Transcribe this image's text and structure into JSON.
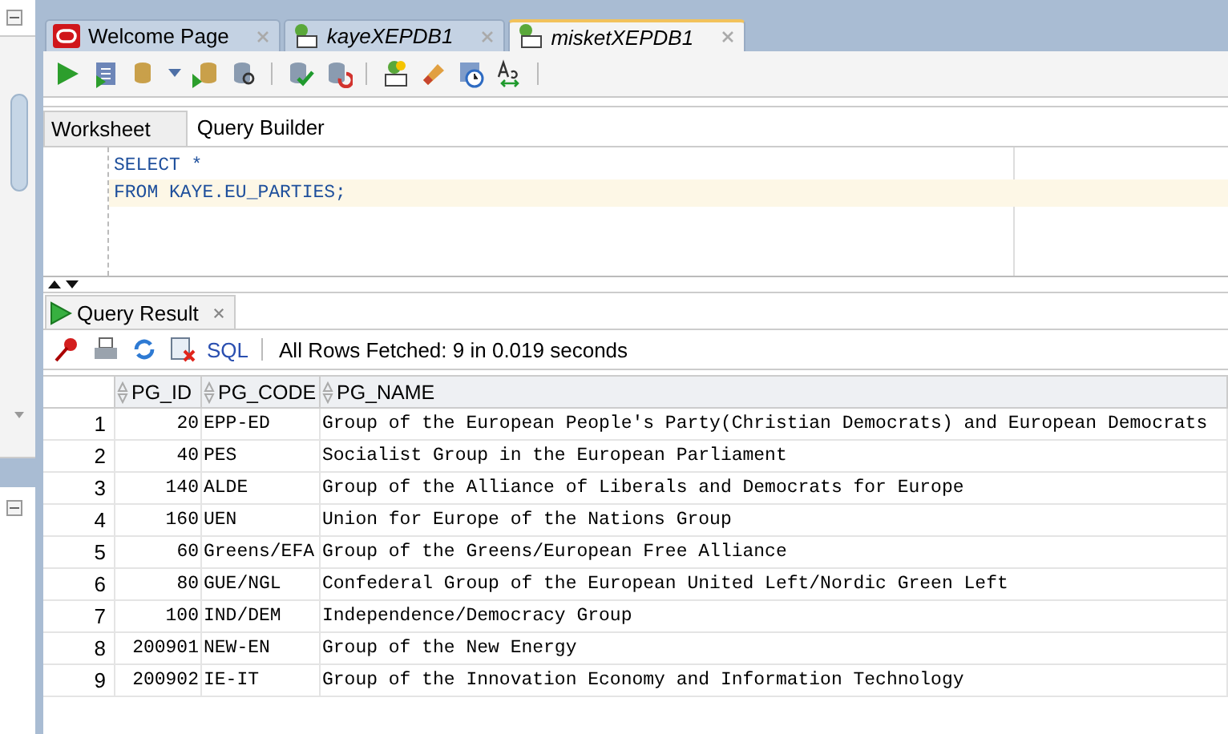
{
  "document_tabs": [
    {
      "label": "Welcome Page",
      "kind": "oracle",
      "selected": false
    },
    {
      "label": "kayeXEPDB1",
      "kind": "sql",
      "selected": false
    },
    {
      "label": "misketXEPDB1",
      "kind": "sql",
      "selected": true
    }
  ],
  "editor_tabs": [
    {
      "label": "Worksheet",
      "selected": true
    },
    {
      "label": "Query Builder",
      "selected": false
    }
  ],
  "editor": {
    "lines": [
      {
        "text": "SELECT *",
        "current": false
      },
      {
        "text": "FROM KAYE.EU_PARTIES;",
        "current": true
      }
    ]
  },
  "result_tab": {
    "label": "Query Result"
  },
  "result_toolbar": {
    "sql_link": "SQL",
    "status": "All Rows Fetched: 9 in 0.019 seconds"
  },
  "table": {
    "columns": [
      "PG_ID",
      "PG_CODE",
      "PG_NAME"
    ],
    "rows": [
      {
        "number": "1",
        "cells": [
          "20",
          "EPP-ED",
          "Group of the European People's Party(Christian Democrats) and European Democrats"
        ]
      },
      {
        "number": "2",
        "cells": [
          "40",
          "PES",
          "Socialist Group in the European Parliament"
        ]
      },
      {
        "number": "3",
        "cells": [
          "140",
          "ALDE",
          "Group of the Alliance of Liberals and Democrats for Europe"
        ]
      },
      {
        "number": "4",
        "cells": [
          "160",
          "UEN",
          "Union for Europe of the Nations Group"
        ]
      },
      {
        "number": "5",
        "cells": [
          "60",
          "Greens/EFA",
          "Group of the Greens/European Free Alliance"
        ]
      },
      {
        "number": "6",
        "cells": [
          "80",
          "GUE/NGL",
          "Confederal Group of the European United Left/Nordic Green Left"
        ]
      },
      {
        "number": "7",
        "cells": [
          "100",
          "IND/DEM",
          "Independence/Democracy Group"
        ]
      },
      {
        "number": "8",
        "cells": [
          "200901",
          "NEW-EN",
          "Group of the New Energy"
        ]
      },
      {
        "number": "9",
        "cells": [
          "200902",
          "IE-IT",
          "Group of the Innovation Economy and Information Technology"
        ]
      }
    ]
  }
}
